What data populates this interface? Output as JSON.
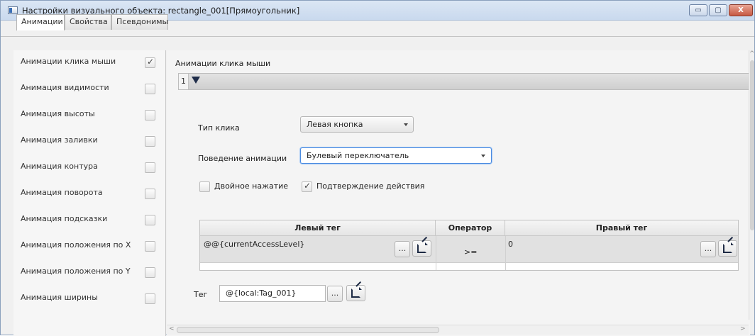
{
  "window": {
    "title": "Настройки визуального объекта: rectangle_001[Прямоугольник]",
    "min_glyph": "▭",
    "max_glyph": "▢",
    "close_glyph": "X"
  },
  "tabs": [
    {
      "label": "Анимации",
      "active": true
    },
    {
      "label": "Свойства",
      "active": false
    },
    {
      "label": "Псевдонимы",
      "active": false
    }
  ],
  "animations": [
    {
      "label": "Анимации клика мыши",
      "checked": true
    },
    {
      "label": "Анимация видимости",
      "checked": false
    },
    {
      "label": "Анимация высоты",
      "checked": false
    },
    {
      "label": "Анимация заливки",
      "checked": false
    },
    {
      "label": "Анимация контура",
      "checked": false
    },
    {
      "label": "Анимация поворота",
      "checked": false
    },
    {
      "label": "Анимация подсказки",
      "checked": false
    },
    {
      "label": "Анимация положения по X",
      "checked": false
    },
    {
      "label": "Анимация положения по Y",
      "checked": false
    },
    {
      "label": "Анимация ширины",
      "checked": false
    }
  ],
  "detail": {
    "section_title": "Анимации клика мыши",
    "step_number": "1",
    "click_type_label": "Тип клика",
    "click_type_value": "Левая кнопка",
    "behavior_label": "Поведение анимации",
    "behavior_value": "Булевый переключатель",
    "double_click_label": "Двойное нажатие",
    "double_click_checked": false,
    "confirm_label": "Подтверждение действия",
    "confirm_checked": true,
    "table": {
      "headers": [
        "Левый тег",
        "Оператор",
        "Правый тег"
      ],
      "rows": [
        {
          "left": "@@{currentAccessLevel}",
          "operator": ">=",
          "right": "0"
        }
      ]
    },
    "tag_label": "Тег",
    "tag_value": "@{local:Tag_001}",
    "dots_label": "..."
  },
  "colors": {
    "focus": "#4b8be0",
    "titlebar": "#c9d9ee",
    "close": "#c75a44"
  }
}
